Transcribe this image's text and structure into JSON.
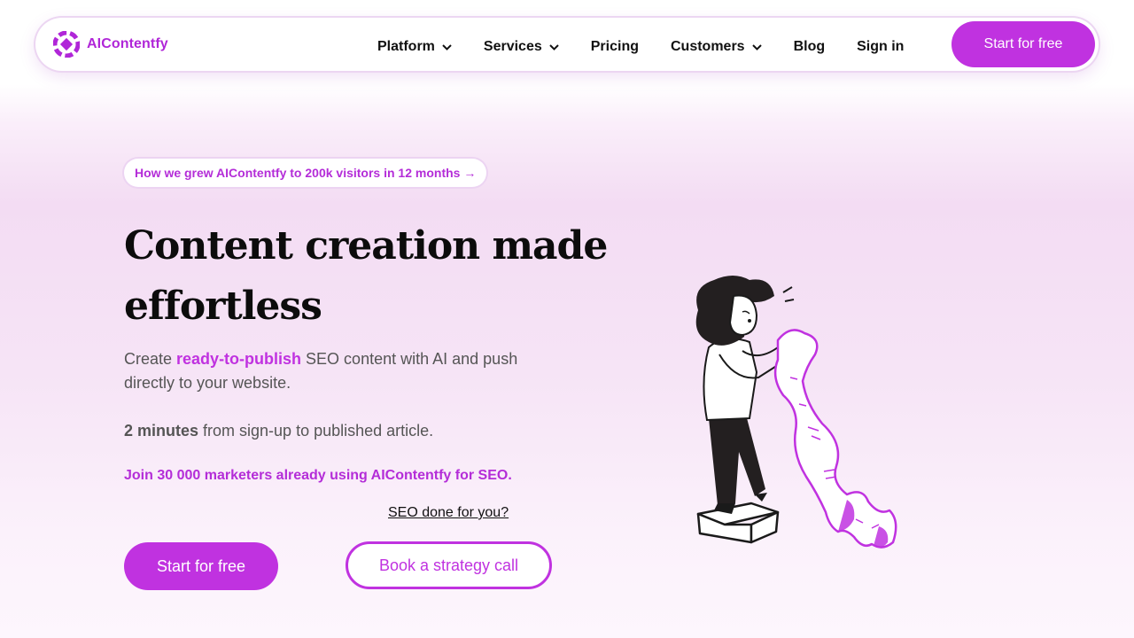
{
  "brand": {
    "name": "AIContentfy",
    "accent": "#c032e0",
    "logo_icon": "aicontentfy-logo-icon"
  },
  "nav": {
    "items": [
      {
        "label": "Platform",
        "dropdown": true
      },
      {
        "label": "Services",
        "dropdown": true
      },
      {
        "label": "Pricing",
        "dropdown": false
      },
      {
        "label": "Customers",
        "dropdown": true
      },
      {
        "label": "Blog",
        "dropdown": false
      },
      {
        "label": "Sign in",
        "dropdown": false
      }
    ],
    "cta_label": "Start for free"
  },
  "hero": {
    "announcement": "How we grew AIContentfy to 200k visitors in 12 months →",
    "headline": "Content creation made effortless",
    "description": {
      "prefix": "Create ",
      "highlight": "ready-to-publish",
      "suffix": " SEO content with AI and push directly to your website."
    },
    "speed": {
      "bold": "2 minutes",
      "rest": " from sign-up to published article."
    },
    "join_text": "Join 30 000 marketers already using AIContentfy for SEO.",
    "seo_link": "SEO done for you?",
    "primary_button": "Start for free",
    "secondary_button": "Book a strategy call",
    "illustration_icon": "woman-reading-scroll-illustration"
  }
}
